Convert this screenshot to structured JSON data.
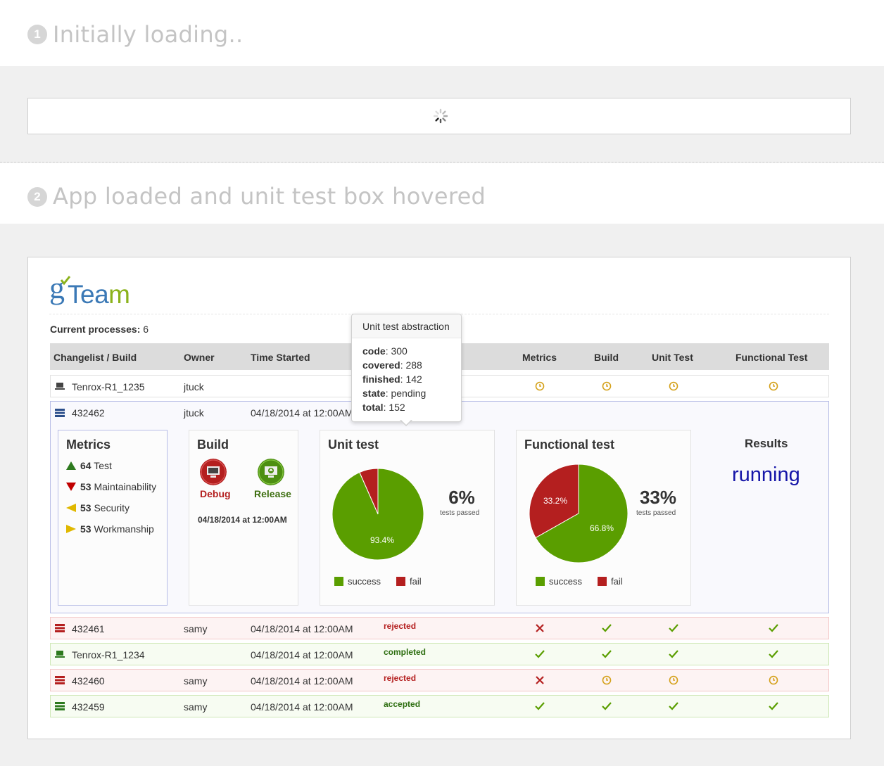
{
  "section1": {
    "number": "1",
    "title": "Initially loading.."
  },
  "section2": {
    "number": "2",
    "title": "App loaded and unit test box hovered"
  },
  "app": {
    "logo": {
      "prefix": "g",
      "text1": "Tea",
      "text2": "m"
    },
    "current_processes_label": "Current processes:",
    "current_processes_value": "6",
    "columns": {
      "changelist": "Changelist / Build",
      "owner": "Owner",
      "time_started": "Time Started",
      "metrics": "Metrics",
      "build": "Build",
      "unit_test": "Unit Test",
      "functional_test": "Functional Test"
    },
    "rows": [
      {
        "id": "Tenrox-R1_1235",
        "owner": "jtuck",
        "time": "",
        "state": "",
        "icon": "computer-icon",
        "metrics": "pending-icon",
        "build": "pending-icon",
        "unit": "pending-icon",
        "functional": "pending-icon"
      },
      {
        "id": "432462",
        "owner": "jtuck",
        "time": "04/18/2014 at 12:00AM",
        "state": "",
        "icon": "server-icon"
      },
      {
        "id": "432461",
        "owner": "samy",
        "time": "04/18/2014 at 12:00AM",
        "state": "rejected",
        "icon": "server-icon",
        "metrics": "fail-icon",
        "build": "check-icon",
        "unit": "check-icon",
        "functional": "check-icon"
      },
      {
        "id": "Tenrox-R1_1234",
        "owner": "",
        "time": "04/18/2014 at 12:00AM",
        "state": "completed",
        "icon": "computer-icon",
        "metrics": "check-icon",
        "build": "check-icon",
        "unit": "check-icon",
        "functional": "check-icon"
      },
      {
        "id": "432460",
        "owner": "samy",
        "time": "04/18/2014 at 12:00AM",
        "state": "rejected",
        "icon": "server-icon",
        "metrics": "fail-icon",
        "build": "pending-icon",
        "unit": "pending-icon",
        "functional": "pending-icon"
      },
      {
        "id": "432459",
        "owner": "samy",
        "time": "04/18/2014 at 12:00AM",
        "state": "accepted",
        "icon": "server-icon",
        "metrics": "check-icon",
        "build": "check-icon",
        "unit": "check-icon",
        "functional": "check-icon"
      }
    ],
    "details": {
      "metrics": {
        "title": "Metrics",
        "items": [
          {
            "value": "64",
            "label": "Test",
            "trend": "up"
          },
          {
            "value": "53",
            "label": "Maintainability",
            "trend": "down"
          },
          {
            "value": "53",
            "label": "Security",
            "trend": "left"
          },
          {
            "value": "53",
            "label": "Workmanship",
            "trend": "right"
          }
        ]
      },
      "build": {
        "title": "Build",
        "debug_label": "Debug",
        "release_label": "Release",
        "time": "04/18/2014 at 12:00AM"
      },
      "unit_test": {
        "title": "Unit test",
        "percent": "6%",
        "percent_sub": "tests passed",
        "success_label": "success",
        "fail_label": "fail",
        "success_slice_label": "93.4%"
      },
      "functional_test": {
        "title": "Functional test",
        "percent": "33%",
        "percent_sub": "tests passed",
        "success_label": "success",
        "fail_label": "fail",
        "success_slice_label": "66.8%",
        "fail_slice_label": "33.2%"
      },
      "results": {
        "title": "Results",
        "value": "running"
      }
    },
    "tooltip": {
      "title": "Unit test abstraction",
      "items": [
        {
          "key": "code",
          "value": "300"
        },
        {
          "key": "covered",
          "value": "288"
        },
        {
          "key": "finished",
          "value": "142"
        },
        {
          "key": "state",
          "value": "pending"
        },
        {
          "key": "total",
          "value": "152"
        }
      ]
    }
  },
  "colors": {
    "success": "#5a9e00",
    "fail": "#b41f1f",
    "pending": "#d4a017",
    "results": "#1515a8"
  },
  "chart_data": [
    {
      "type": "pie",
      "title": "Unit test",
      "categories": [
        "success",
        "fail"
      ],
      "values": [
        93.4,
        6.6
      ]
    },
    {
      "type": "pie",
      "title": "Functional test",
      "categories": [
        "success",
        "fail"
      ],
      "values": [
        66.8,
        33.2
      ]
    }
  ]
}
